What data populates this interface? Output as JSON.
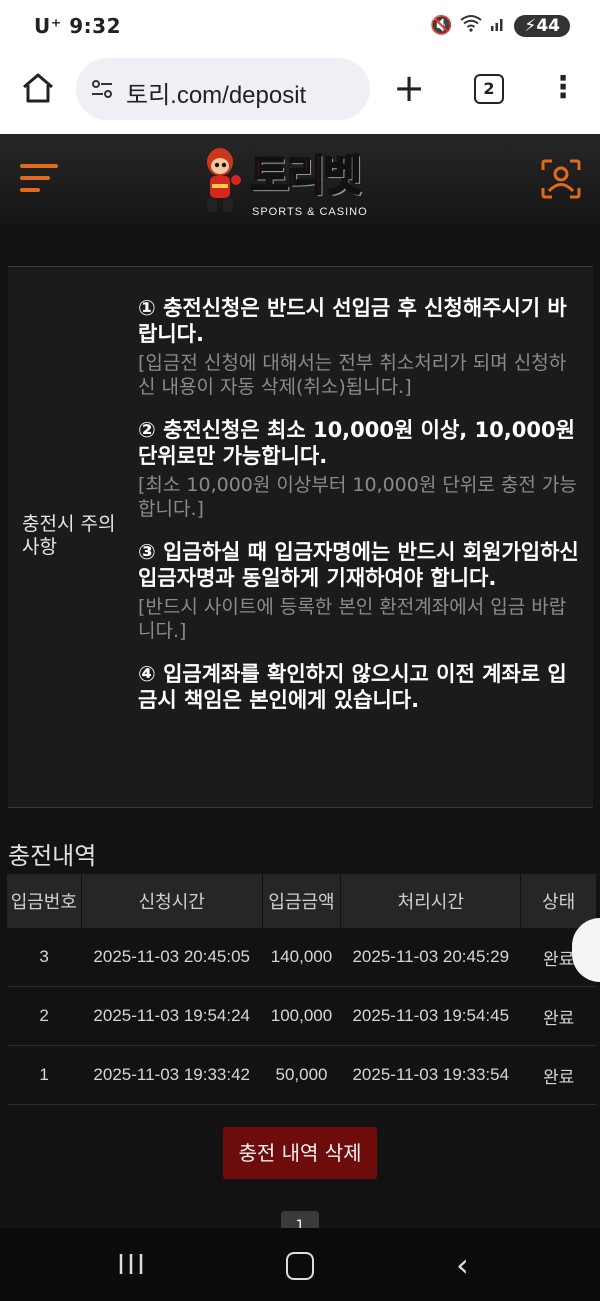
{
  "status_bar": {
    "carrier_time": "U⁺ 9:32",
    "battery": "44"
  },
  "browser": {
    "url": "토리.com/deposit",
    "tab_count": "2"
  },
  "site": {
    "logo_text": "토리벳",
    "logo_sub": "SPORTS & CASINO"
  },
  "notice": {
    "label": "충전시 주의사항",
    "items": [
      {
        "main": "① 충전신청은 반드시 선입금 후 신청해주시기 바랍니다.",
        "detail": "[입금전 신청에 대해서는 전부 취소처리가 되며 신청하신 내용이 자동 삭제(취소)됩니다.]"
      },
      {
        "main": "② 충전신청은 최소 10,000원 이상, 10,000원 단위로만 가능합니다.",
        "detail": "[최소 10,000원 이상부터 10,000원 단위로 충전 가능합니다.]"
      },
      {
        "main": "③ 입금하실 때 입금자명에는 반드시 회원가입하신 입금자명과 동일하게 기재하여야 합니다.",
        "detail": "[반드시 사이트에 등록한 본인 환전계좌에서 입금 바랍니다.]"
      },
      {
        "main": "④ 입금계좌를 확인하지 않으시고 이전 계좌로 입금시 책임은 본인에게 있습니다.",
        "detail": ""
      }
    ]
  },
  "history": {
    "title": "충전내역",
    "columns": [
      "입금번호",
      "신청시간",
      "입금금액",
      "처리시간",
      "상태"
    ],
    "rows": [
      [
        "3",
        "2025-11-03 20:45:05",
        "140,000",
        "2025-11-03 20:45:29",
        "완료"
      ],
      [
        "2",
        "2025-11-03 19:54:24",
        "100,000",
        "2025-11-03 19:54:45",
        "완료"
      ],
      [
        "1",
        "2025-11-03 19:33:42",
        "50,000",
        "2025-11-03 19:33:54",
        "완료"
      ]
    ],
    "delete_label": "충전 내역 삭제",
    "page": "1"
  },
  "colors": {
    "accent": "#e06a1c",
    "brand_red": "#e41e2a",
    "delete_button": "#6e0c0c"
  }
}
